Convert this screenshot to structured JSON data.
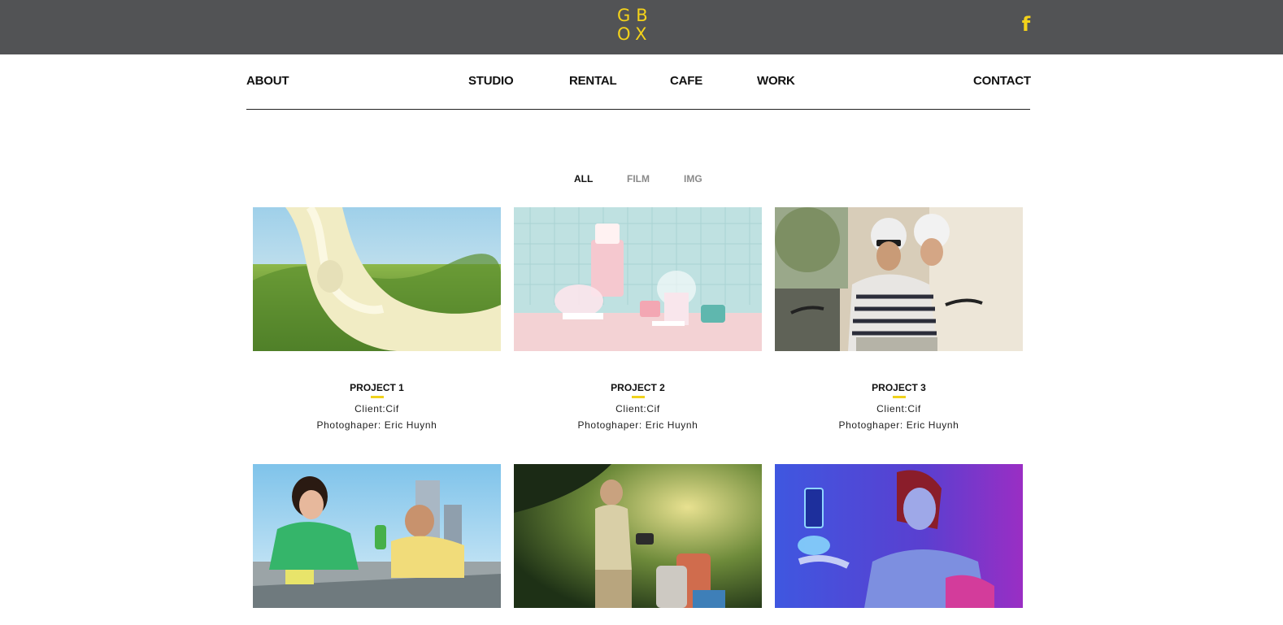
{
  "header": {
    "logo_line1": "GB",
    "logo_line2": "OX",
    "facebook_glyph": "f",
    "accent_color": "#f4d21a",
    "bar_color": "#525355"
  },
  "nav": {
    "about": "ABOUT",
    "studio": "STUDIO",
    "rental": "RENTAL",
    "cafe": "CAFE",
    "work": "WORK",
    "contact": "CONTACT"
  },
  "filters": {
    "all": "ALL",
    "film": "FILM",
    "img": "IMG",
    "active": "ALL"
  },
  "projects": [
    {
      "title": "PROJECT 1",
      "client": "Client:Cif",
      "photographer": "Photoghaper: Eric Huynh",
      "image": "milk-splash-tea-field"
    },
    {
      "title": "PROJECT 2",
      "client": "Client:Cif",
      "photographer": "Photoghaper: Eric Huynh",
      "image": "pastel-cakes-handbag"
    },
    {
      "title": "PROJECT 3",
      "client": "Client:Cif",
      "photographer": "Photoghaper: Eric Huynh",
      "image": "couple-on-scooter"
    },
    {
      "image": "cleaning-city-ad"
    },
    {
      "image": "jungle-explorer-suitcase"
    },
    {
      "image": "woman-blue-phone-hologram"
    }
  ]
}
